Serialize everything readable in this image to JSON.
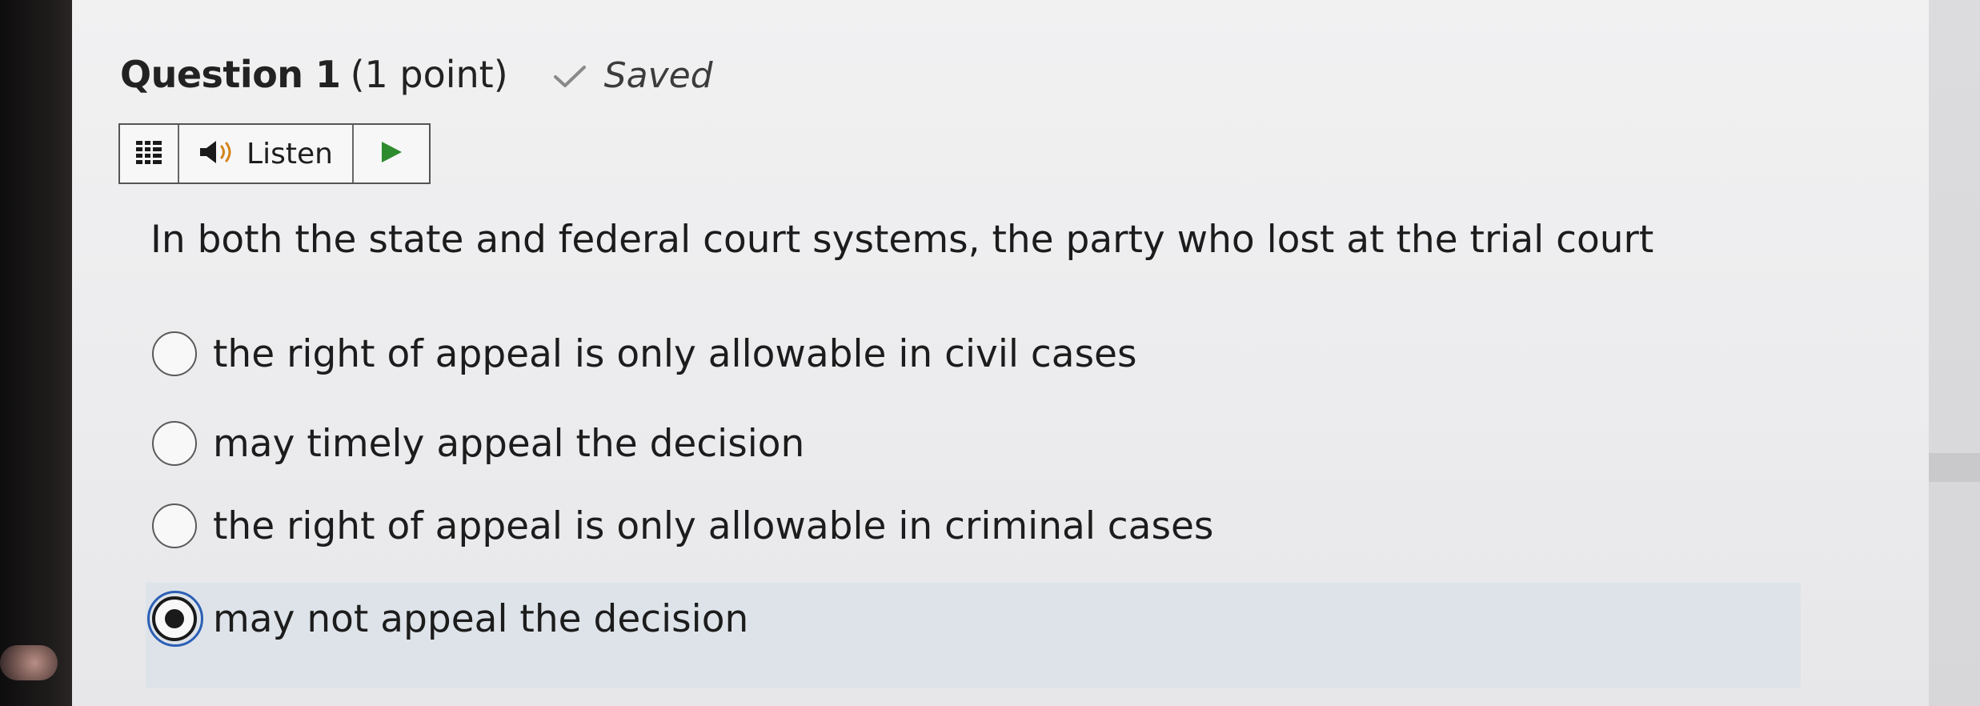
{
  "question": {
    "title": "Question 1",
    "points": "(1 point)",
    "status": "Saved",
    "text": "In both the state and federal court systems, the party who lost at the trial court"
  },
  "toolbar": {
    "listen_label": "Listen"
  },
  "options": [
    {
      "label": "the right of appeal is only allowable in civil cases",
      "selected": false
    },
    {
      "label": "may timely appeal the decision",
      "selected": false
    },
    {
      "label": "the right of appeal is only allowable in criminal cases",
      "selected": false
    },
    {
      "label": "may not appeal the decision",
      "selected": true
    }
  ],
  "icons": {
    "saved": "check-icon",
    "menu": "menu-icon",
    "speaker": "speaker-icon",
    "play": "play-icon"
  },
  "colors": {
    "play_accent": "#2e8b2e",
    "selected_row_bg": "#dde3e9",
    "focus_ring": "#2b5fb5",
    "saved_check": "#8a8a8a"
  }
}
